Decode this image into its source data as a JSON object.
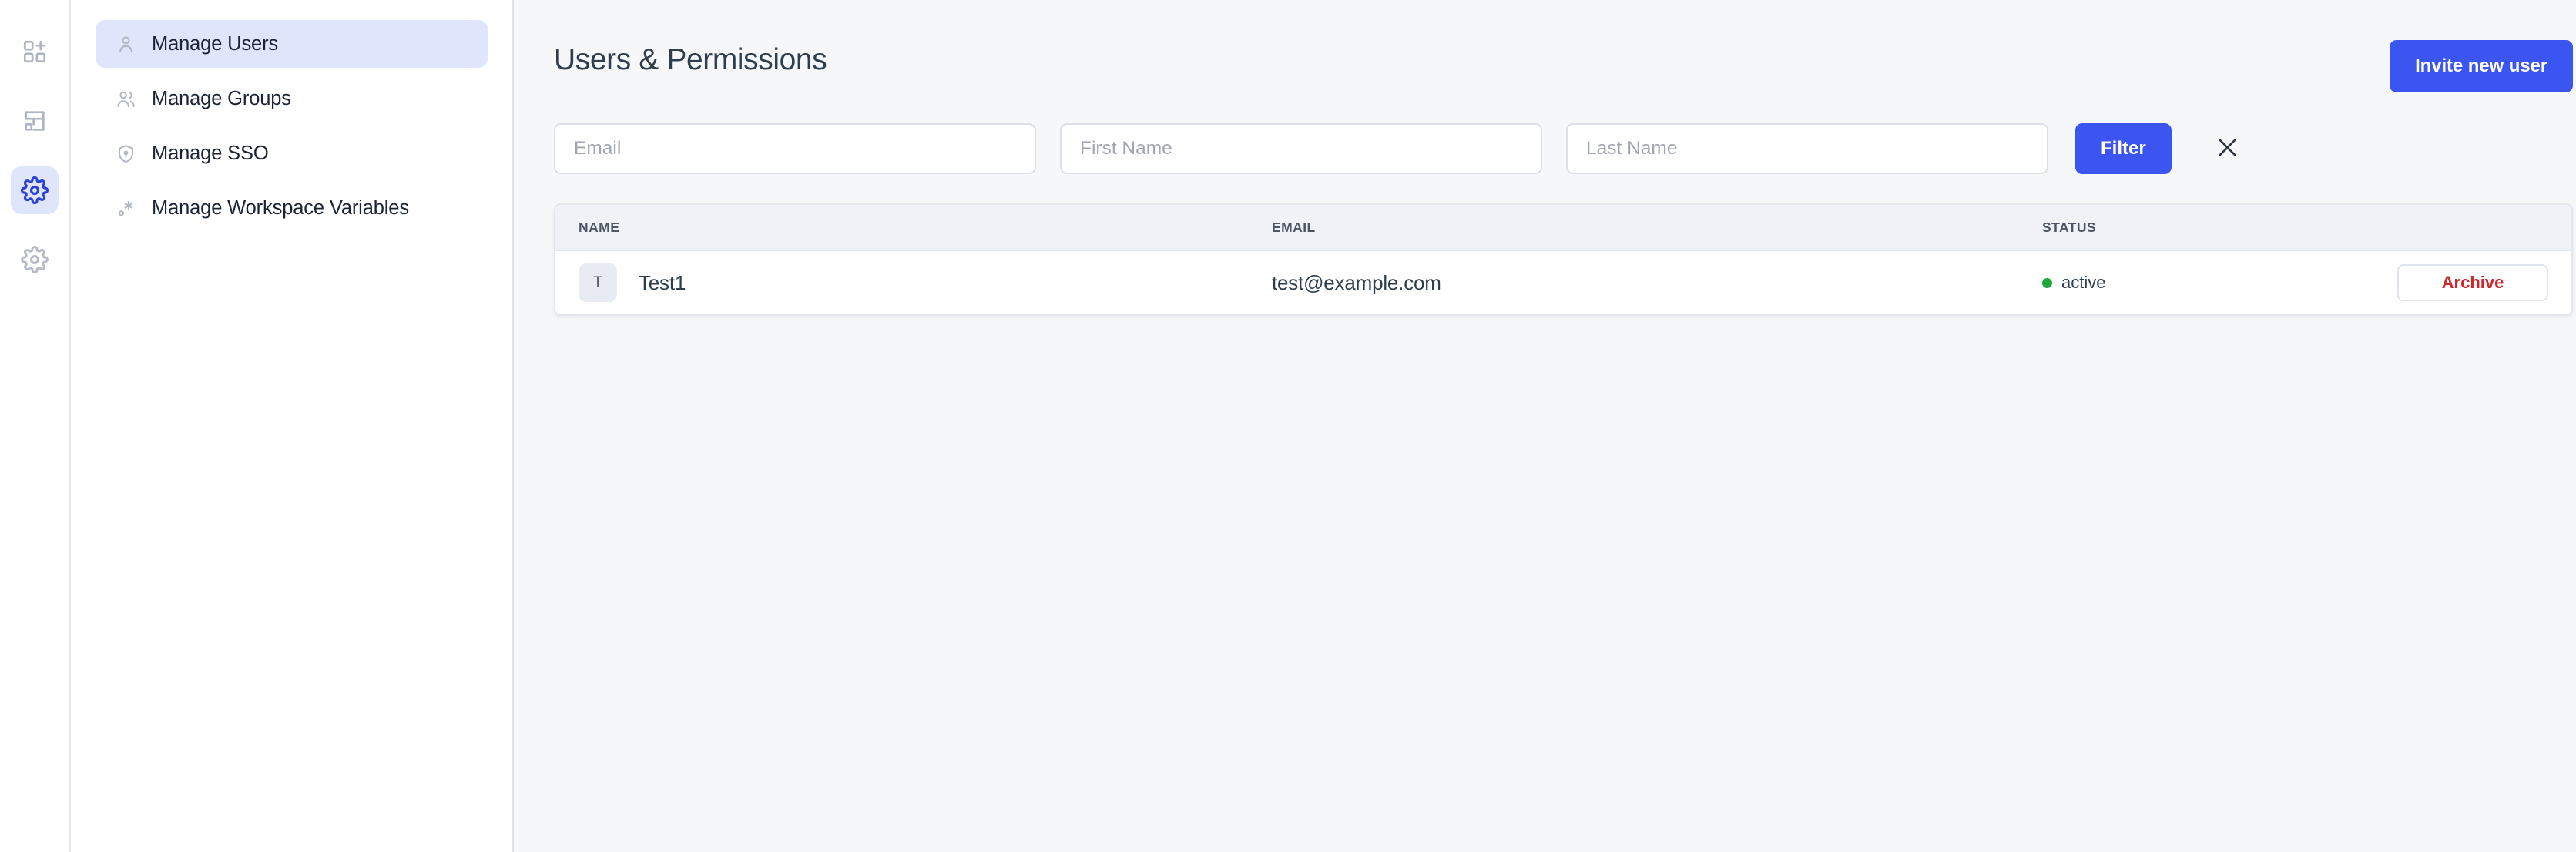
{
  "rail": {
    "items": [
      {
        "icon": "grid-plus-icon",
        "name": "create-app",
        "active": false
      },
      {
        "icon": "dashboard-layout-icon",
        "name": "workspace-layout",
        "active": false
      },
      {
        "icon": "gear-icon",
        "name": "workspace-settings",
        "active": true
      },
      {
        "icon": "gear-icon",
        "name": "account-settings",
        "active": false
      }
    ]
  },
  "sidebar": {
    "items": [
      {
        "label": "Manage Users",
        "icon": "user-icon",
        "active": true
      },
      {
        "label": "Manage Groups",
        "icon": "users-group-icon",
        "active": false
      },
      {
        "label": "Manage SSO",
        "icon": "shield-lock-icon",
        "active": false
      },
      {
        "label": "Manage Workspace Variables",
        "icon": "variable-asterisk-icon",
        "active": false
      }
    ]
  },
  "header": {
    "title": "Users & Permissions",
    "invite_label": "Invite new user"
  },
  "filters": {
    "email_placeholder": "Email",
    "email_value": "",
    "first_name_placeholder": "First Name",
    "first_name_value": "",
    "last_name_placeholder": "Last Name",
    "last_name_value": "",
    "filter_label": "Filter",
    "clear_icon": "close-icon"
  },
  "table": {
    "columns": [
      "NAME",
      "EMAIL",
      "STATUS"
    ],
    "rows": [
      {
        "avatar_initial": "T",
        "name": "Test1",
        "email": "test@example.com",
        "status": "active",
        "action_label": "Archive"
      }
    ]
  },
  "colors": {
    "accent_blue": "#3b55f0",
    "active_nav_bg": "#dfe5fb",
    "status_green": "#1fa83c",
    "archive_red": "#d0252b",
    "page_bg": "#f6f7f9",
    "table_head_bg": "#eff2f7"
  }
}
